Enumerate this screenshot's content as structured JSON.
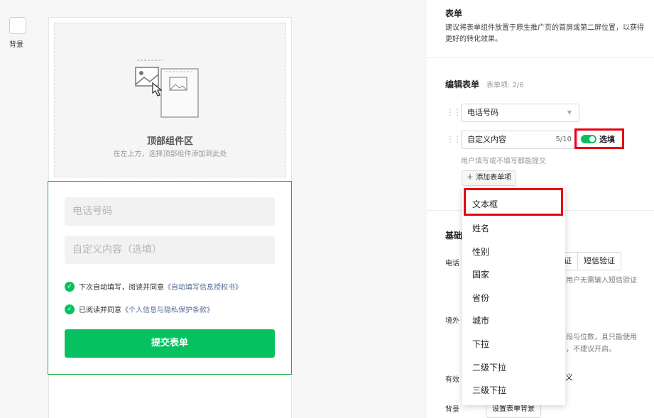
{
  "rail": {
    "label": "背景"
  },
  "canvas": {
    "top_zone_title": "顶部组件区",
    "top_zone_hint": "在左上方，选择顶部组件添加到此处",
    "phone_placeholder": "电话号码",
    "custom_placeholder": "自定义内容（选填）",
    "consent1_text": "下次自动填写，阅读并同意",
    "consent1_link": "《自动填写信息授权书》",
    "consent2_text": "已阅读并同意",
    "consent2_link": "《个人信息与隐私保护条款》",
    "submit_label": "提交表单"
  },
  "panel": {
    "form_title": "表单",
    "form_desc": "建议将表单组件放置于原生推广页的首屏或第二屏位置，以获得更好的转化效果。",
    "edit_title": "编辑表单",
    "edit_meta": "表单项: 2/6",
    "phone_select": "电话号码",
    "custom_value": "自定义内容",
    "custom_count": "5/10",
    "optional_label": "选填",
    "optional_hint": "用户填写或不填写都能提交",
    "add_label": "添加表单项",
    "basic_title": "基础",
    "phone_row_label": "电话",
    "verify_left": "证",
    "verify_right": "短信验证",
    "verify_note": "用户无需输入短信验证",
    "overseas_label": "境外",
    "overseas_note_1": "段与位数，且只能使用",
    "overseas_note_2": "，不建议开启。",
    "valid_label": "有效",
    "valid_right": "义",
    "bg_label": "背景",
    "bg_button": "设置表单背景"
  },
  "dropdown": {
    "items": [
      "文本框",
      "姓名",
      "性别",
      "国家",
      "省份",
      "城市",
      "下拉",
      "二级下拉",
      "三级下拉"
    ]
  },
  "colors": {
    "accent": "#07c160",
    "highlight": "#e60012",
    "link": "#576b95"
  }
}
